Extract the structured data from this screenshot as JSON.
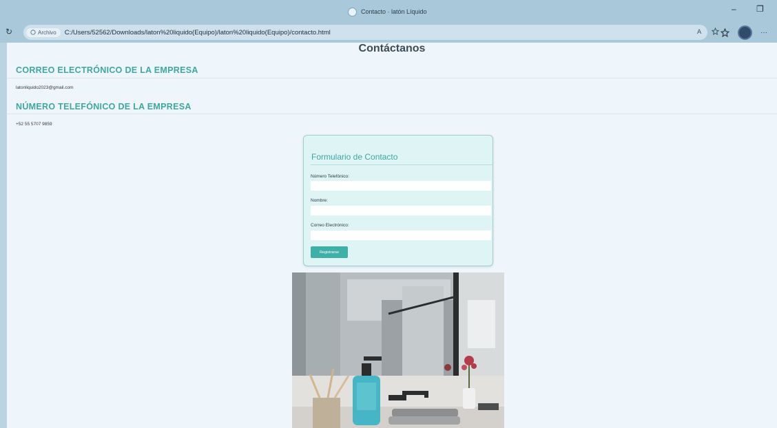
{
  "browser": {
    "tab_title": "Contacto · latón Líquido",
    "site_info_label": "Archivo",
    "url": "C:/Users/52562/Downloads/laton%20liquido(Equipo)/laton%20liquido(Equipo)/contacto.html",
    "minimize_glyph": "–",
    "maximize_glyph": "❐",
    "reload_glyph": "↻",
    "more_glyph": "···"
  },
  "page": {
    "title": "Contáctanos",
    "sections": [
      {
        "heading": "CORREO ELECTRÓNICO DE LA EMPRESA",
        "text": "latonliquido2023@gmail.com"
      },
      {
        "heading": "NÚMERO TELEFÓNICO DE LA EMPRESA",
        "text": "+52 55 5707 9859"
      }
    ],
    "form": {
      "title": "Formulario de Contacto",
      "fields": [
        {
          "label": "Número Telefónico:",
          "value": ""
        },
        {
          "label": "Nombre:",
          "value": ""
        },
        {
          "label": "Correo Electrónico:",
          "value": ""
        }
      ],
      "submit_label": "Registrarse"
    }
  },
  "colors": {
    "accent": "#3fa6a0",
    "button": "#3fb0a8",
    "form_bg": "#def4f5",
    "page_bg": "#eef6fb",
    "chrome_bg": "#a9c8d9"
  }
}
